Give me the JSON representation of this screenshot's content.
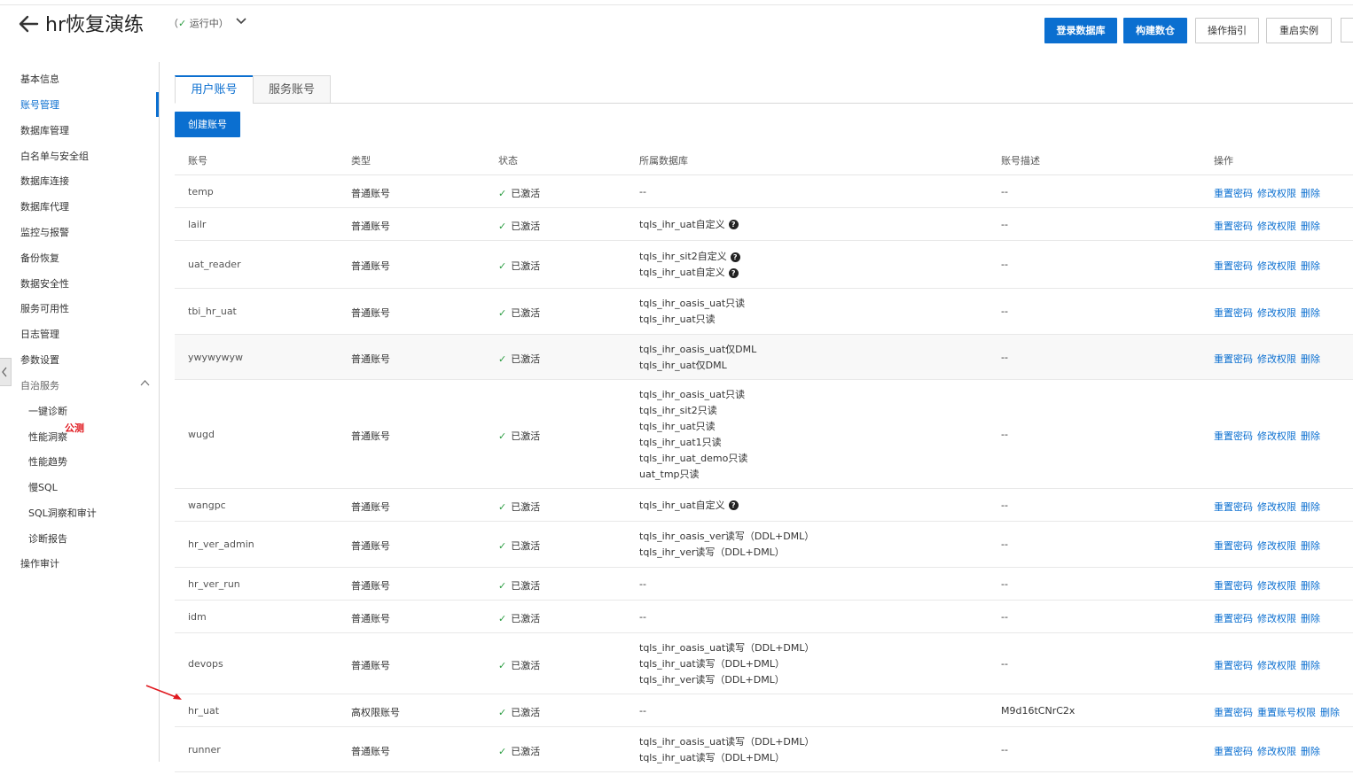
{
  "header": {
    "title": "hr恢复演练",
    "status_prefix": "（",
    "status_check": "✓",
    "status_text": "运行中",
    "status_suffix": "）",
    "buttons": {
      "login_db": "登录数据库",
      "build_warehouse": "构建数仓",
      "guide": "操作指引",
      "restart": "重启实例"
    }
  },
  "sidebar": {
    "items": [
      "基本信息",
      "账号管理",
      "数据库管理",
      "白名单与安全组",
      "数据库连接",
      "数据库代理",
      "监控与报警",
      "备份恢复",
      "数据安全性",
      "服务可用性",
      "日志管理",
      "参数设置",
      "自治服务"
    ],
    "sub_items": [
      "一键诊断",
      "性能洞察",
      "性能趋势",
      "慢SQL",
      "SQL洞察和审计",
      "诊断报告"
    ],
    "beta_badge": "公测",
    "last_item": "操作审计"
  },
  "tabs": [
    "用户账号",
    "服务账号"
  ],
  "create_button": "创建账号",
  "table": {
    "columns": [
      "账号",
      "类型",
      "状态",
      "所属数据库",
      "账号描述",
      "操作"
    ],
    "state_check": "✓",
    "op_reset": "重置密码",
    "op_modify": "修改权限",
    "op_reset_perm": "重置账号权限",
    "op_delete": "删除",
    "rows": [
      {
        "account": "temp",
        "type": "普通账号",
        "state": "已激活",
        "dbs": [
          "--"
        ],
        "desc": "--",
        "special": false
      },
      {
        "account": "lailr",
        "type": "普通账号",
        "state": "已激活",
        "dbs": [
          "tqls_ihr_uat自定义"
        ],
        "help": [
          true
        ],
        "desc": "--",
        "special": false
      },
      {
        "account": "uat_reader",
        "type": "普通账号",
        "state": "已激活",
        "dbs": [
          "tqls_ihr_sit2自定义",
          "tqls_ihr_uat自定义"
        ],
        "help": [
          true,
          true
        ],
        "desc": "--",
        "special": false
      },
      {
        "account": "tbi_hr_uat",
        "type": "普通账号",
        "state": "已激活",
        "dbs": [
          "tqls_ihr_oasis_uat只读",
          "tqls_ihr_uat只读"
        ],
        "desc": "--",
        "special": false
      },
      {
        "account": "ywywywyw",
        "type": "普通账号",
        "state": "已激活",
        "dbs": [
          "tqls_ihr_oasis_uat仅DML",
          "tqls_ihr_uat仅DML"
        ],
        "desc": "--",
        "special": false
      },
      {
        "account": "wugd",
        "type": "普通账号",
        "state": "已激活",
        "dbs": [
          "tqls_ihr_oasis_uat只读",
          "tqls_ihr_sit2只读",
          "tqls_ihr_uat只读",
          "tqls_ihr_uat1只读",
          "tqls_ihr_uat_demo只读",
          "uat_tmp只读"
        ],
        "desc": "--",
        "special": false
      },
      {
        "account": "wangpc",
        "type": "普通账号",
        "state": "已激活",
        "dbs": [
          "tqls_ihr_uat自定义"
        ],
        "help": [
          true
        ],
        "desc": "--",
        "special": false
      },
      {
        "account": "hr_ver_admin",
        "type": "普通账号",
        "state": "已激活",
        "dbs": [
          "tqls_ihr_oasis_ver读写（DDL+DML）",
          "tqls_ihr_ver读写（DDL+DML）"
        ],
        "desc": "--",
        "special": false
      },
      {
        "account": "hr_ver_run",
        "type": "普通账号",
        "state": "已激活",
        "dbs": [
          "--"
        ],
        "desc": "--",
        "special": false
      },
      {
        "account": "idm",
        "type": "普通账号",
        "state": "已激活",
        "dbs": [
          "--"
        ],
        "desc": "--",
        "special": false
      },
      {
        "account": "devops",
        "type": "普通账号",
        "state": "已激活",
        "dbs": [
          "tqls_ihr_oasis_uat读写（DDL+DML）",
          "tqls_ihr_uat读写（DDL+DML）",
          "tqls_ihr_ver读写（DDL+DML）"
        ],
        "desc": "--",
        "special": false
      },
      {
        "account": "hr_uat",
        "type": "高权限账号",
        "state": "已激活",
        "dbs": [
          "--"
        ],
        "desc": "M9d16tCNrC2x",
        "special": true
      },
      {
        "account": "runner",
        "type": "普通账号",
        "state": "已激活",
        "dbs": [
          "tqls_ihr_oasis_uat读写（DDL+DML）",
          "tqls_ihr_uat读写（DDL+DML）"
        ],
        "desc": "--",
        "special": false
      }
    ]
  },
  "colors": {
    "accent": "#0b6fd0",
    "success": "#2e9e44",
    "beta": "#e0181e",
    "arrow": "#e0181e"
  }
}
